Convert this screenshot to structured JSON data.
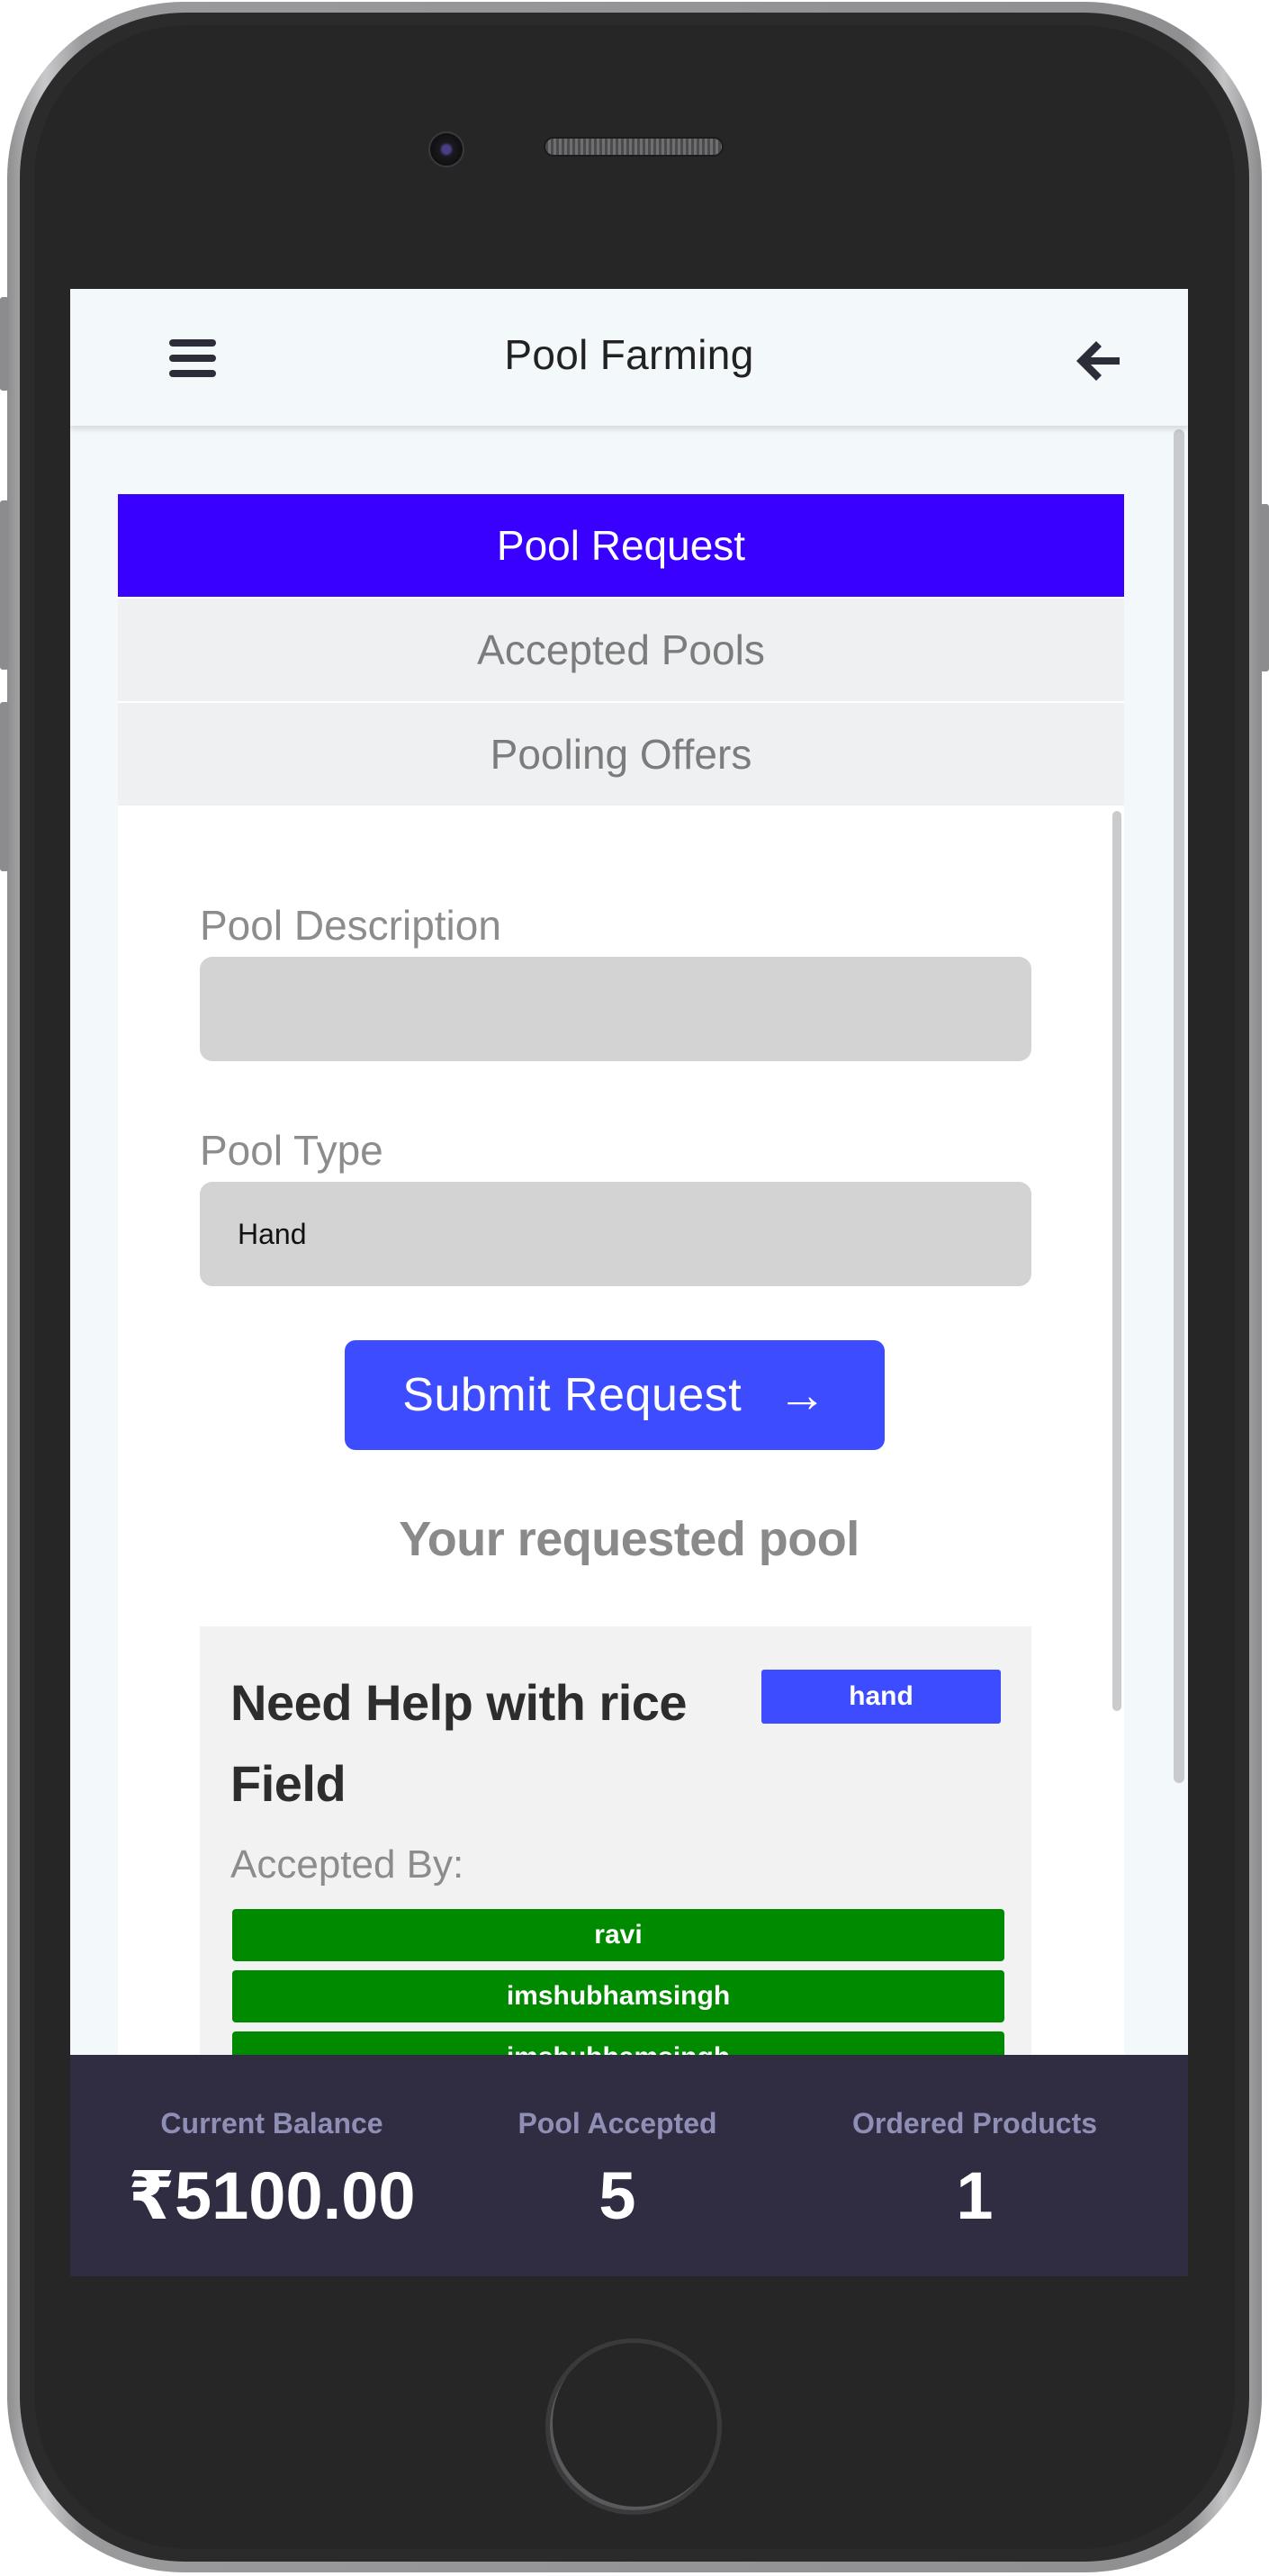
{
  "header": {
    "title": "Pool Farming"
  },
  "tabs": [
    {
      "label": "Pool Request",
      "active": true
    },
    {
      "label": "Accepted Pools",
      "active": false
    },
    {
      "label": "Pooling Offers",
      "active": false
    }
  ],
  "form": {
    "description_label": "Pool Description",
    "description_value": "",
    "type_label": "Pool Type",
    "type_value": "Hand",
    "submit_label": "Submit Request",
    "submit_icon": "→"
  },
  "requested": {
    "heading": "Your requested pool",
    "card": {
      "title": "Need Help with rice Field",
      "badge": "hand",
      "accepted_by_label": "Accepted By:",
      "accepted_by": [
        "ravi",
        "imshubhamsingh",
        "imshubhamsingh"
      ]
    }
  },
  "footer": {
    "stats": [
      {
        "label": "Current Balance",
        "value": "₹5100.00"
      },
      {
        "label": "Pool Accepted",
        "value": "5"
      },
      {
        "label": "Ordered Products",
        "value": "1"
      }
    ]
  },
  "colors": {
    "active_tab": "#3a00ff",
    "primary_button": "#3d4cff",
    "accepted_user": "#008a00",
    "footer_bg": "#302d43"
  }
}
